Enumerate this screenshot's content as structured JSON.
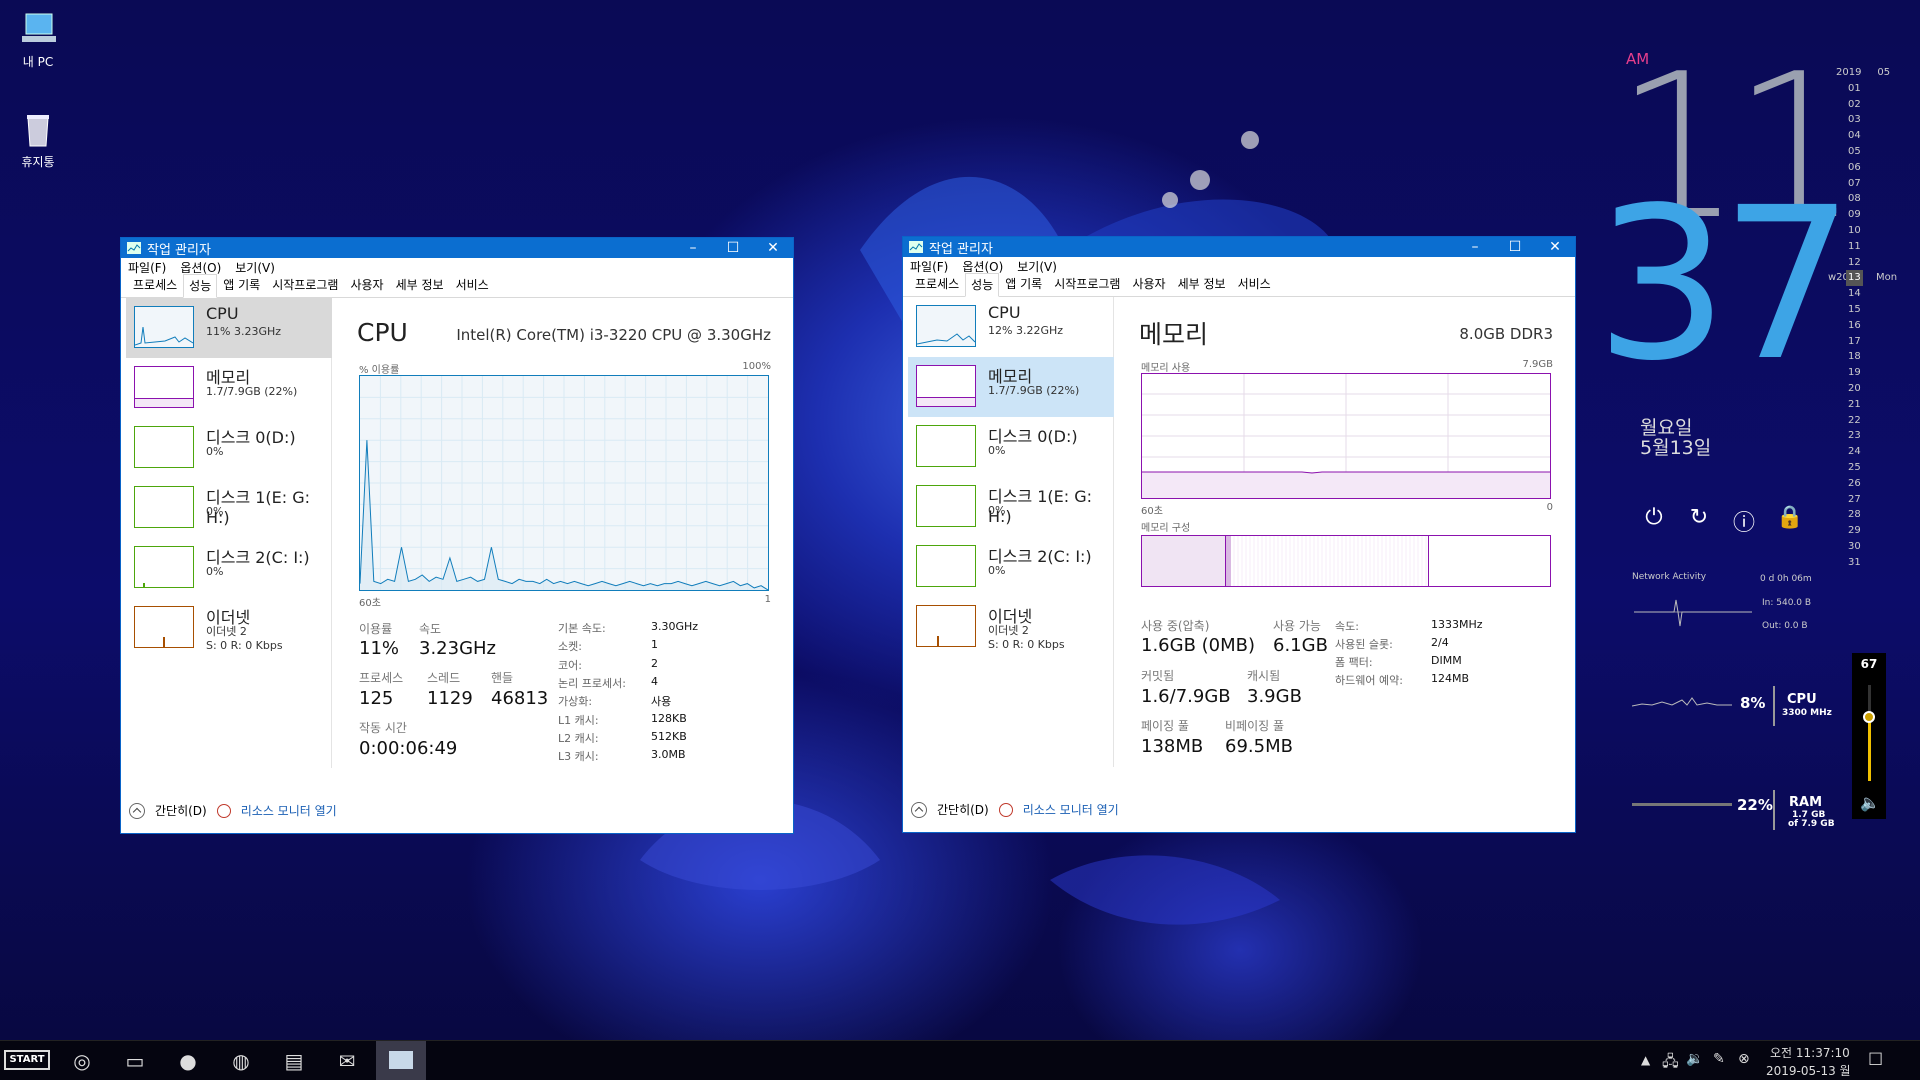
{
  "desktop": {
    "icons": [
      {
        "label": "내 PC"
      },
      {
        "label": "휴지통"
      }
    ]
  },
  "window1": {
    "title": "작업 관리자",
    "menu": [
      "파일(F)",
      "옵션(O)",
      "보기(V)"
    ],
    "tabs": [
      "프로세스",
      "성능",
      "앱 기록",
      "시작프로그램",
      "사용자",
      "세부 정보",
      "서비스"
    ],
    "sidebar": [
      {
        "name": "CPU",
        "sub": "11% 3.23GHz"
      },
      {
        "name": "메모리",
        "sub": "1.7/7.9GB (22%)"
      },
      {
        "name": "디스크 0(D:)",
        "sub": "0%"
      },
      {
        "name": "디스크 1(E: G: H:)",
        "sub": "0%"
      },
      {
        "name": "디스크 2(C: I:)",
        "sub": "0%"
      },
      {
        "name": "이더넷",
        "sub": "이더넷 2",
        "sub2": "S: 0 R: 0 Kbps"
      }
    ],
    "main": {
      "title": "CPU",
      "model": "Intel(R) Core(TM) i3-3220 CPU @ 3.30GHz",
      "graph_top_left": "% 이용률",
      "graph_top_right": "100%",
      "graph_bottom_left": "60초",
      "graph_bottom_right": "1"
    },
    "stats": {
      "util_label": "이용률",
      "util": "11%",
      "speed_label": "속도",
      "speed": "3.23GHz",
      "proc_label": "프로세스",
      "proc": "125",
      "thread_label": "스레드",
      "thread": "1129",
      "handle_label": "핸들",
      "handle": "46813",
      "uptime_label": "작동 시간",
      "uptime": "0:00:06:49"
    },
    "kv": [
      {
        "k": "기본 속도:",
        "v": "3.30GHz"
      },
      {
        "k": "소켓:",
        "v": "1"
      },
      {
        "k": "코어:",
        "v": "2"
      },
      {
        "k": "논리 프로세서:",
        "v": "4"
      },
      {
        "k": "가상화:",
        "v": "사용"
      },
      {
        "k": "L1 캐시:",
        "v": "128KB"
      },
      {
        "k": "L2 캐시:",
        "v": "512KB"
      },
      {
        "k": "L3 캐시:",
        "v": "3.0MB"
      }
    ],
    "footer": {
      "fewer": "간단히(D)",
      "monitor": "리소스 모니터 열기"
    },
    "cpu_series": [
      0,
      2,
      1,
      3,
      2,
      4,
      3,
      2,
      3,
      4,
      3,
      2,
      3,
      4,
      3,
      3,
      2,
      3,
      2,
      3,
      4,
      3,
      2,
      3,
      4,
      3,
      2,
      3,
      4,
      3,
      4,
      3,
      5,
      3,
      4,
      4,
      5,
      3,
      4,
      5,
      20,
      5,
      4,
      6,
      5,
      4,
      15,
      5,
      6,
      4,
      7,
      5,
      4,
      20,
      4,
      5,
      3,
      4,
      70,
      3
    ]
  },
  "window2": {
    "title": "작업 관리자",
    "menu": [
      "파일(F)",
      "옵션(O)",
      "보기(V)"
    ],
    "tabs": [
      "프로세스",
      "성능",
      "앱 기록",
      "시작프로그램",
      "사용자",
      "세부 정보",
      "서비스"
    ],
    "sidebar": [
      {
        "name": "CPU",
        "sub": "12% 3.22GHz"
      },
      {
        "name": "메모리",
        "sub": "1.7/7.9GB (22%)"
      },
      {
        "name": "디스크 0(D:)",
        "sub": "0%"
      },
      {
        "name": "디스크 1(E: G: H:)",
        "sub": "0%"
      },
      {
        "name": "디스크 2(C: I:)",
        "sub": "0%"
      },
      {
        "name": "이더넷",
        "sub": "이더넷 2",
        "sub2": "S: 0 R: 0 Kbps"
      }
    ],
    "main": {
      "title": "메모리",
      "model": "8.0GB DDR3",
      "graph_top_left": "메모리 사용",
      "graph_top_right": "7.9GB",
      "graph_bottom_left": "60초",
      "graph_bottom_right": "0",
      "comp_label": "메모리 구성"
    },
    "stats": {
      "inuse_label": "사용 중(압축)",
      "inuse": "1.6GB (0MB)",
      "avail_label": "사용 가능",
      "avail": "6.1GB",
      "commit_label": "커밋됨",
      "commit": "1.6/7.9GB",
      "cached_label": "캐시됨",
      "cached": "3.9GB",
      "paged_label": "페이징 풀",
      "paged": "138MB",
      "nonpaged_label": "비페이징 풀",
      "nonpaged": "69.5MB"
    },
    "kv": [
      {
        "k": "속도:",
        "v": "1333MHz"
      },
      {
        "k": "사용된 슬롯:",
        "v": "2/4"
      },
      {
        "k": "폼 팩터:",
        "v": "DIMM"
      },
      {
        "k": "하드웨어 예약:",
        "v": "124MB"
      }
    ],
    "footer": {
      "fewer": "간단히(D)",
      "monitor": "리소스 모니터 열기"
    }
  },
  "widget": {
    "am": "AM",
    "hour": "11",
    "minute": "37",
    "weekday": "월요일",
    "date": "5월13일",
    "cal_year": "2019",
    "cal_month": "05",
    "week": "w20",
    "today": "13",
    "day_name": "Mon",
    "days": [
      "01",
      "02",
      "03",
      "04",
      "05",
      "06",
      "07",
      "08",
      "09",
      "10",
      "11",
      "12",
      "13",
      "14",
      "15",
      "16",
      "17",
      "18",
      "19",
      "20",
      "21",
      "22",
      "23",
      "24",
      "25",
      "26",
      "27",
      "28",
      "29",
      "30",
      "31"
    ],
    "net_title": "Network Activity",
    "net_uptime": "0 d 0h 06m",
    "net_in": "In: 540.0 B",
    "net_out": "Out: 0.0 B",
    "cpu_pct": "8%",
    "cpu_lbl": "CPU",
    "cpu_mhz": "3300 MHz",
    "ram_pct": "22%",
    "ram_lbl": "RAM",
    "ram_used": "1.7 GB",
    "ram_of": "of 7.9 GB",
    "volume": "67"
  },
  "taskbar": {
    "start": "START",
    "time": "오전 11:37:10",
    "date": "2019-05-13 월"
  }
}
